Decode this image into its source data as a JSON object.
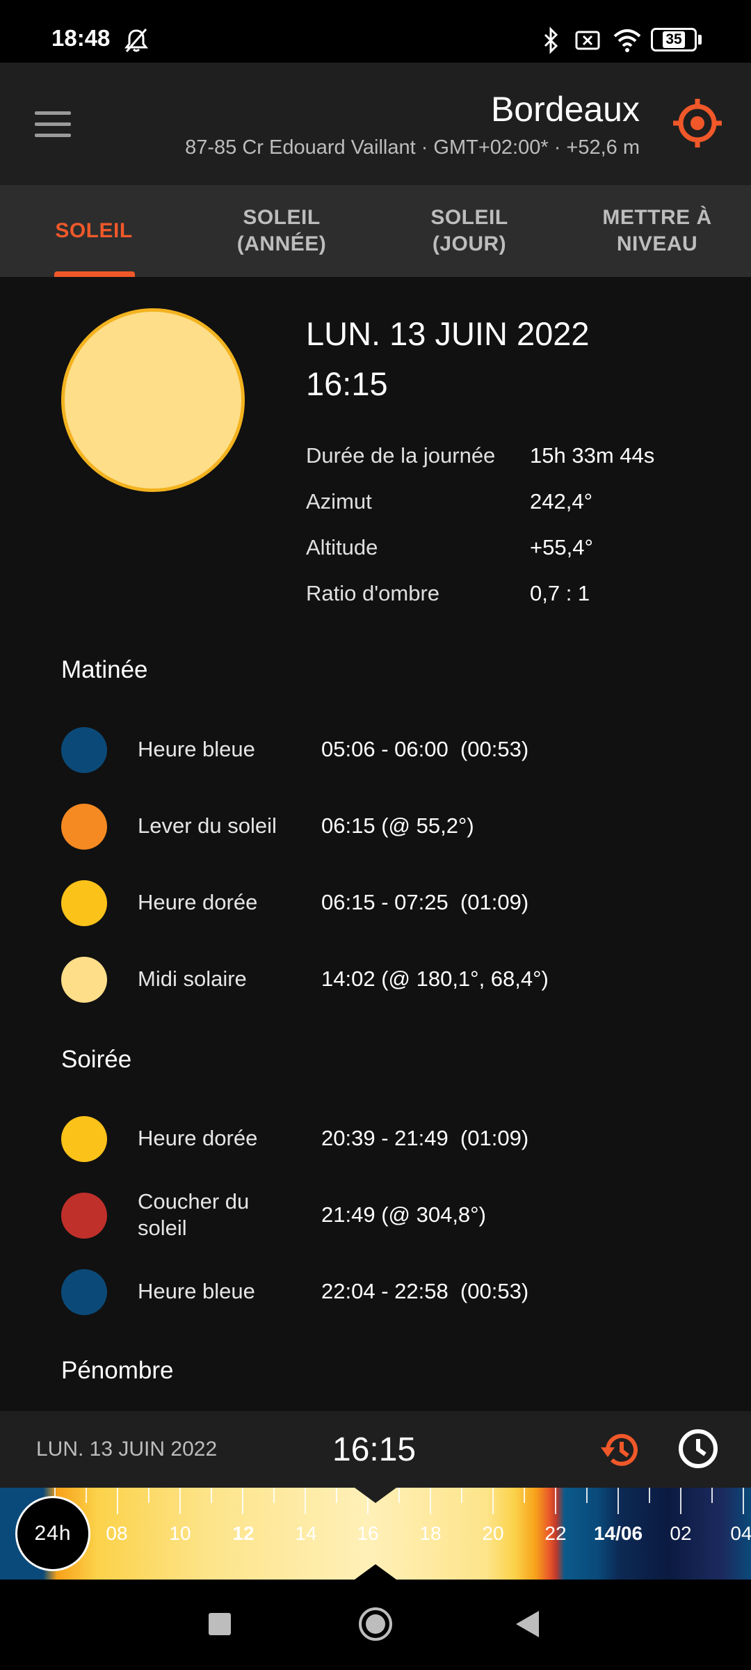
{
  "status_bar": {
    "time": "18:48",
    "battery": "35"
  },
  "header": {
    "city": "Bordeaux",
    "address": "87-85 Cr Edouard Vaillant  ·  GMT+02:00*  ·  +52,6 m"
  },
  "tabs": [
    {
      "label": "SOLEIL",
      "active": true
    },
    {
      "label": "SOLEIL\n(ANNÉE)",
      "active": false
    },
    {
      "label": "SOLEIL\n(JOUR)",
      "active": false
    },
    {
      "label": "METTRE À\nNIVEAU",
      "active": false
    }
  ],
  "summary": {
    "date": "LUN. 13 JUIN 2022",
    "time": "16:15",
    "stats": [
      {
        "label": "Durée de la journée",
        "value": "15h 33m 44s"
      },
      {
        "label": "Azimut",
        "value": "242,4°"
      },
      {
        "label": "Altitude",
        "value": "+55,4°"
      },
      {
        "label": "Ratio d'ombre",
        "value": "0,7 : 1"
      }
    ]
  },
  "morning": {
    "title": "Matinée",
    "events": [
      {
        "label": "Heure bleue",
        "value": "05:06 - 06:00  (00:53)",
        "color": "#0b4a78"
      },
      {
        "label": "Lever du soleil",
        "value": "06:15 (@ 55,2°)",
        "color": "#f58a22"
      },
      {
        "label": "Heure dorée",
        "value": "06:15 - 07:25  (01:09)",
        "color": "#fbc21a"
      },
      {
        "label": "Midi solaire",
        "value": "14:02 (@ 180,1°, 68,4°)",
        "color": "#ffde8a"
      }
    ]
  },
  "evening": {
    "title": "Soirée",
    "events": [
      {
        "label": "Heure dorée",
        "value": "20:39 - 21:49  (01:09)",
        "color": "#fbc21a"
      },
      {
        "label": "Coucher du soleil",
        "value": "21:49 (@ 304,8°)",
        "color": "#c0302a"
      },
      {
        "label": "Heure bleue",
        "value": "22:04 - 22:58  (00:53)",
        "color": "#0b4a78"
      }
    ]
  },
  "penumbra": {
    "title": "Pénombre"
  },
  "time_bar": {
    "date": "LUN. 13 JUIN 2022",
    "time": "16:15"
  },
  "timeline": {
    "mode_button": "24h",
    "labels": [
      "08",
      "10",
      "12",
      "14",
      "16",
      "18",
      "20",
      "22",
      "14/06",
      "02",
      "04"
    ],
    "bold_labels": [
      "12",
      "14/06"
    ]
  },
  "colors": {
    "accent": "#f0582a",
    "background": "#111111",
    "header": "#1f1f1f",
    "tab_bar": "#2d2d2d"
  }
}
